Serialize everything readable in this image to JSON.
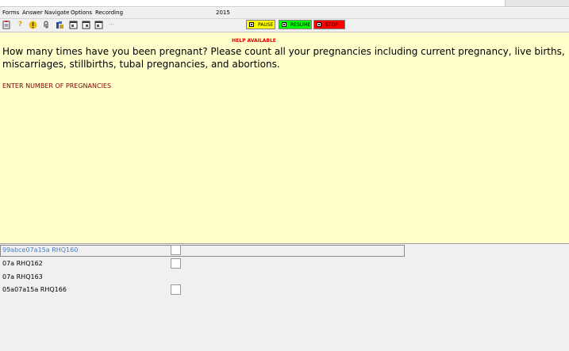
{
  "menu": {
    "items": [
      "Forms",
      "Answer",
      "Navigate",
      "Options",
      "Recording"
    ],
    "year": "2015"
  },
  "toolbar": {
    "icons": [
      "forms-icon",
      "help-question-icon",
      "alert-icon",
      "attachment-icon",
      "navigate-icon",
      "window-icon",
      "window-icon",
      "window-icon",
      "more-icon"
    ],
    "more_label": "···",
    "pause_label": "PAUSE",
    "resume_label": "RESUME",
    "stop_label": "STOP",
    "colors": {
      "pause": "#ffff00",
      "resume": "#00ff00",
      "stop": "#ff0000"
    }
  },
  "question": {
    "help": "HELP AVAILABLE",
    "text": "How many times have you been pregnant? Please count all your pregnancies including current pregnancy, live births, miscarriages, stillbirths, tubal pregnancies, and abortions.",
    "instruction": "ENTER NUMBER OF PREGNANCIES",
    "background": "#ffffcc"
  },
  "answers": [
    {
      "label": "99abce07a15a RHQ160",
      "active": true,
      "has_box": true
    },
    {
      "label": "07a RHQ162",
      "active": false,
      "has_box": true
    },
    {
      "label": "07a RHQ163",
      "active": false,
      "has_box": false
    },
    {
      "label": "05a07a15a RHQ166",
      "active": false,
      "has_box": true
    }
  ]
}
